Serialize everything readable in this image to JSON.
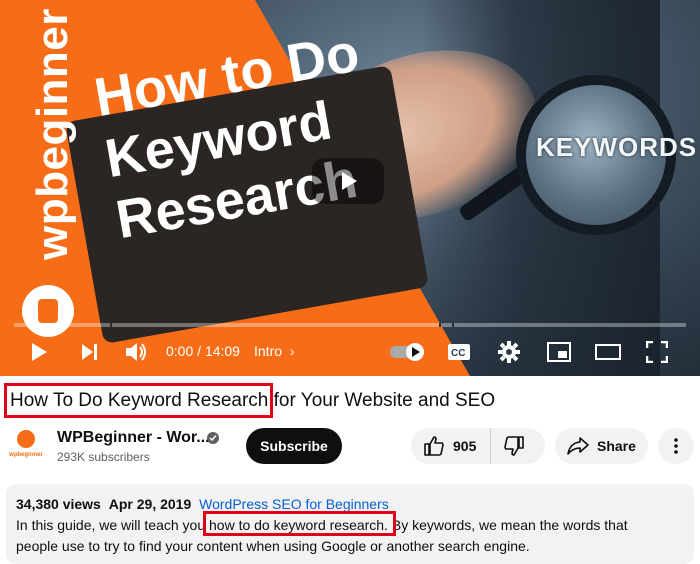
{
  "thumbnail": {
    "title_lines": [
      "How to Do",
      "Keyword",
      "Research"
    ],
    "brand_text": "wpbeginner",
    "magnifier_text": "KEYWORDS"
  },
  "player": {
    "current_time": "0:00",
    "duration": "14:09",
    "time_display": "0:00 / 14:09",
    "chapter": "Intro",
    "progress_fraction": 0,
    "icons": [
      "play-icon",
      "next-icon",
      "volume-icon",
      "autoplay-toggle-icon",
      "captions-icon",
      "settings-gear-icon",
      "miniplayer-icon",
      "theater-mode-icon",
      "fullscreen-icon"
    ]
  },
  "video": {
    "title_highlight": "How To Do Keyword Research",
    "title_rest": " for Your Website and SEO"
  },
  "channel": {
    "name": "WPBeginner - Wor...",
    "subscribers": "293K subscribers",
    "avatar_word": "wpbeginner",
    "subscribe_label": "Subscribe"
  },
  "actions": {
    "likes": "905",
    "share_label": "Share"
  },
  "description": {
    "views": "34,380 views",
    "date": "Apr 29, 2019",
    "playlist": "WordPress SEO for Beginners",
    "line1_before": "In this guide, we will teach you ",
    "line1_highlight": "how to do keyword research.",
    "line1_after": " By keywords, we mean the words that",
    "line2": "people use to try to find your content when using Google or another search engine."
  },
  "colors": {
    "accent_red": "#e0001a",
    "brand_orange": "#f76d17",
    "link_blue": "#065fd4"
  }
}
